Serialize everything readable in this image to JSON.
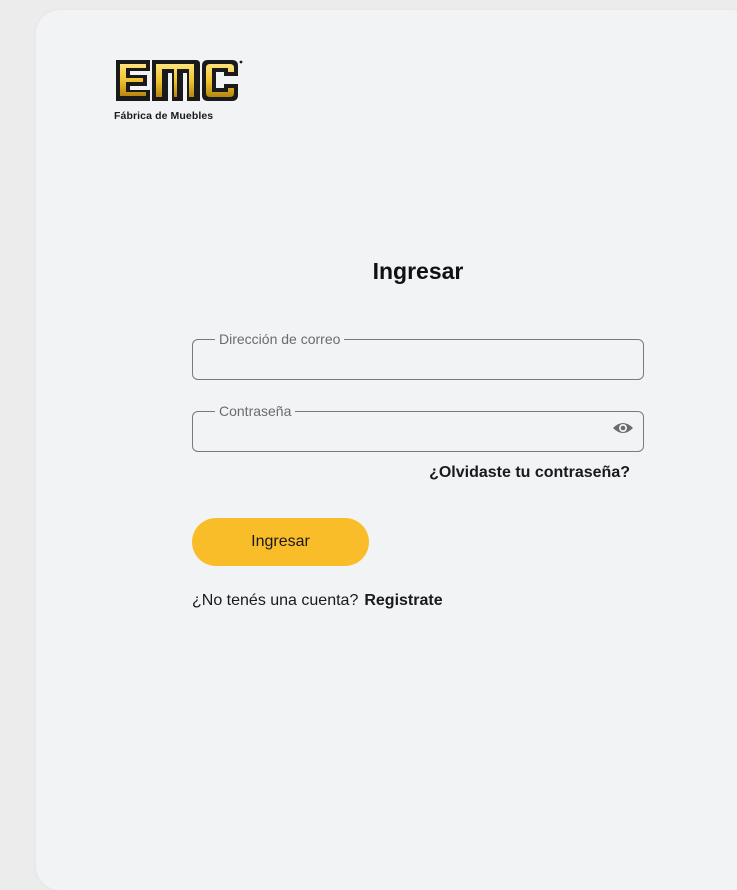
{
  "brand": {
    "logo_text": "EMC",
    "tagline": "Fábrica de Muebles",
    "gold": "#f0c430",
    "dark": "#1a1a1a"
  },
  "form": {
    "title": "Ingresar",
    "email_label": "Dirección de correo",
    "email_value": "",
    "password_label": "Contraseña",
    "password_value": "",
    "show_password_icon": "eye-icon",
    "forgot_link": "¿Olvidaste tu contraseña?",
    "submit_label": "Ingresar",
    "submit_color": "#f9bd29",
    "no_account_text": "¿No tenés una cuenta?",
    "register_link": "Registrate"
  }
}
